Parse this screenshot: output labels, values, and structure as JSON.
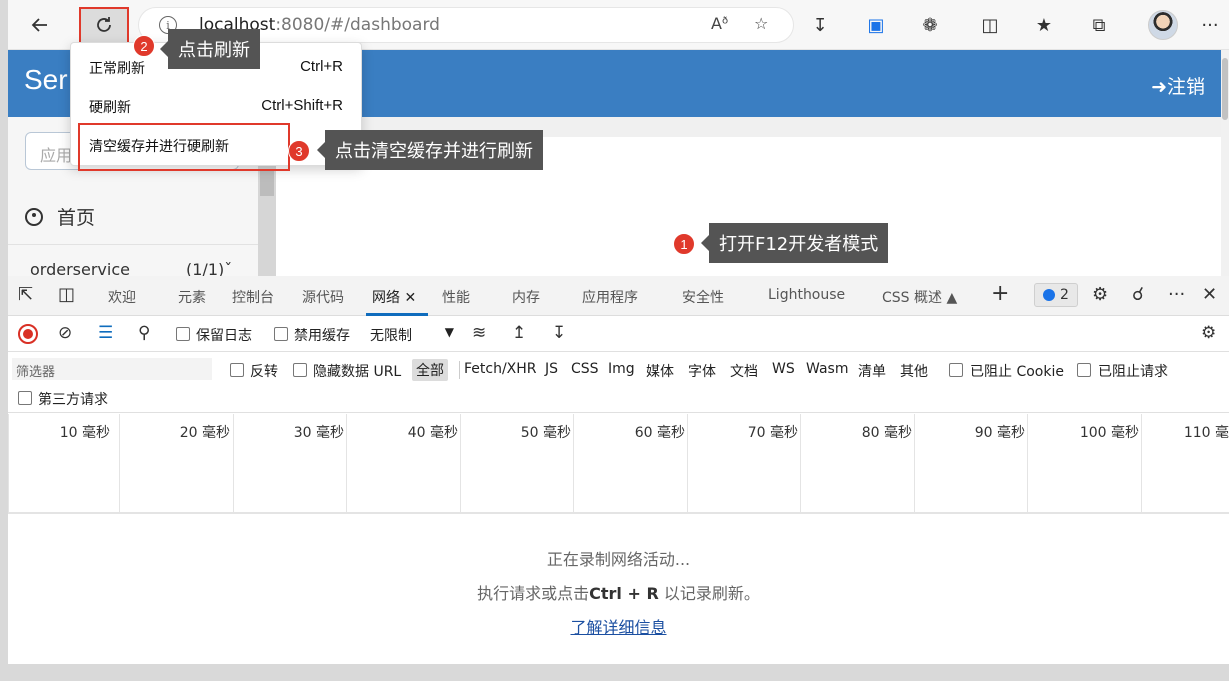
{
  "browser": {
    "url_host": "localhost",
    "url_rest": ":8080/#/dashboard",
    "reader_icon": "Aᶞ",
    "more": "···"
  },
  "page": {
    "brand": "Ser",
    "logout": "注销",
    "search_placeholder": "应用",
    "home": "首页",
    "side_item": "orderservice",
    "side_item_count": "(1/1)"
  },
  "context_menu": {
    "items": [
      {
        "label": "正常刷新",
        "shortcut": "Ctrl+R"
      },
      {
        "label": "硬刷新",
        "shortcut": "Ctrl+Shift+R"
      },
      {
        "label": "清空缓存并进行硬刷新",
        "shortcut": ""
      }
    ]
  },
  "callouts": [
    {
      "num": "1",
      "text": "打开F12开发者模式"
    },
    {
      "num": "2",
      "text": "点击刷新"
    },
    {
      "num": "3",
      "text": "点击清空缓存并进行刷新"
    }
  ],
  "devtools": {
    "tabs": [
      "欢迎",
      "元素",
      "控制台",
      "源代码",
      "网络",
      "性能",
      "内存",
      "应用程序",
      "安全性",
      "Lighthouse",
      "CSS 概述"
    ],
    "issues_count": "2",
    "toolbar": {
      "preserve_log": "保留日志",
      "disable_cache": "禁用缓存",
      "throttle": "无限制"
    },
    "filter": {
      "placeholder": "筛选器",
      "invert": "反转",
      "hide_data_url": "隐藏数据 URL",
      "types": [
        "全部",
        "Fetch/XHR",
        "JS",
        "CSS",
        "Img",
        "媒体",
        "字体",
        "文档",
        "WS",
        "Wasm",
        "清单",
        "其他"
      ],
      "blocked_cookie": "已阻止 Cookie",
      "blocked_requests": "已阻止请求",
      "third_party": "第三方请求"
    },
    "timeline_ticks": [
      "10 毫秒",
      "20 毫秒",
      "30 毫秒",
      "40 毫秒",
      "50 毫秒",
      "60 毫秒",
      "70 毫秒",
      "80 毫秒",
      "90 毫秒",
      "100 毫秒",
      "110 毫"
    ],
    "empty": {
      "line1": "正在录制网络活动...",
      "line2_pre": "执行请求或点击",
      "line2_keys": "Ctrl + R",
      "line2_post": " 以记录刷新。",
      "link": "了解详细信息"
    }
  },
  "colors": {
    "accent": "#e0392b",
    "header_blue": "#3a7ec2",
    "tab_active": "#0f6cbd"
  }
}
